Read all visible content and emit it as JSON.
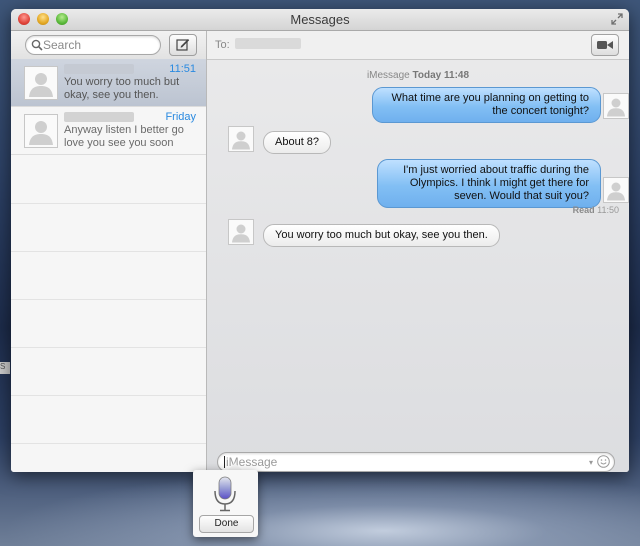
{
  "window": {
    "title": "Messages"
  },
  "sidebar": {
    "search_placeholder": "Search",
    "conversations": [
      {
        "time": "11:51",
        "preview": "You worry too much but okay, see you then.",
        "selected": true
      },
      {
        "time": "Friday",
        "preview": "Anyway listen I better go love you see you soon",
        "selected": false
      }
    ]
  },
  "main": {
    "to_label": "To:",
    "timestamp_prefix": "iMessage",
    "timestamp_bold": "Today 11:48",
    "messages": [
      {
        "direction": "sent",
        "text": "What time are you planning on getting to the concert tonight?"
      },
      {
        "direction": "received",
        "text": "About 8?"
      },
      {
        "direction": "sent",
        "text": "I'm just worried about traffic during the Olympics. I think I might get there for seven. Would that suit you?"
      },
      {
        "direction": "received",
        "text": "You worry too much but okay, see you then."
      }
    ],
    "read_label": "Read",
    "read_time": "11:50",
    "input_placeholder": "iMessage"
  },
  "dictation": {
    "done_label": "Done"
  },
  "desktop": {
    "edge_text": "S"
  },
  "colors": {
    "sent_bubble": "#82bff4",
    "time_accent": "#2a8ae0",
    "selection": "#c5ccd8"
  }
}
